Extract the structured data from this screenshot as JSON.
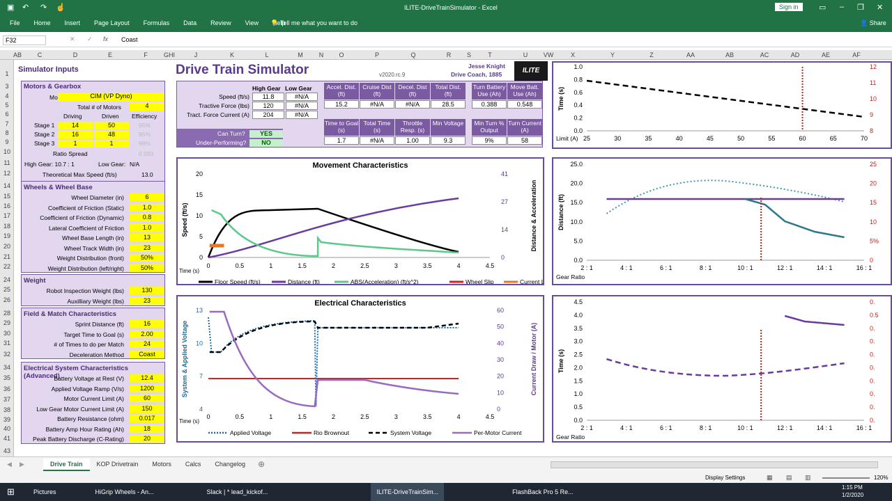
{
  "window": {
    "title": "ILITE-DriveTrainSimulator  -  Excel",
    "signin": "Sign in"
  },
  "ribbon": {
    "items": [
      "File",
      "Home",
      "Insert",
      "Page Layout",
      "Formulas",
      "Data",
      "Review",
      "View",
      "Help"
    ],
    "tell": "Tell me what you want to do",
    "share": "Share"
  },
  "formula": {
    "namebox": "F32",
    "content": "Coast"
  },
  "columns": [
    "AB",
    "C",
    "D",
    "E",
    "F",
    "GHI",
    "J",
    "K",
    "L",
    "M",
    "N",
    "O",
    "P",
    "Q",
    "R",
    "S",
    "T",
    "U",
    "VW",
    "X",
    "Y",
    "Z",
    "AA",
    "AB",
    "AC",
    "AD",
    "AE",
    "AF"
  ],
  "rows": [
    "1",
    "3",
    "4",
    "5",
    "6",
    "7",
    "8",
    "9",
    "10",
    "11",
    "12",
    "14",
    "15",
    "16",
    "17",
    "18",
    "19",
    "20",
    "21",
    "22",
    "24",
    "25",
    "26",
    "28",
    "29",
    "30",
    "31",
    "32",
    "34",
    "35",
    "36",
    "37",
    "38",
    "39",
    "40",
    "41",
    "43"
  ],
  "inputs": {
    "title": "Simulator Inputs",
    "motors_title": "Motors & Gearbox",
    "motor_label": "Motor",
    "motor_value": "CIM (VP Dyno)",
    "total_motors_label": "Total # of Motors",
    "total_motors": "4",
    "driving": "Driving",
    "driven": "Driven",
    "efficiency": "Efficiency",
    "stages": [
      {
        "label": "Stage 1",
        "driving": "14",
        "driven": "50",
        "eff": "95%"
      },
      {
        "label": "Stage 2",
        "driving": "16",
        "driven": "48",
        "eff": "95%"
      },
      {
        "label": "Stage 3",
        "driving": "1",
        "driven": "1",
        "eff": "98%"
      }
    ],
    "ratio_spread_label": "Ratio Spread",
    "ratio_spread": "0.093",
    "high_gear": "High Gear: 10.7 : 1",
    "low_gear": "Low Gear:",
    "low_gear_val": "N/A",
    "theo_label": "Theoretical Max Speed (ft/s)",
    "theo_val": "13.0",
    "wheels_title": "Wheels & Wheel Base",
    "wheels": [
      {
        "label": "Wheel Diameter (in)",
        "value": "6"
      },
      {
        "label": "Coefficient of Friction (Static)",
        "value": "1.0"
      },
      {
        "label": "Coefficient of Friction (Dynamic)",
        "value": "0.8"
      },
      {
        "label": "Lateral Coefficient of Friction",
        "value": "1.0"
      },
      {
        "label": "Wheel Base Length (in)",
        "value": "13"
      },
      {
        "label": "Wheel Track Width (in)",
        "value": "23"
      },
      {
        "label": "Weight Distribution (front)",
        "value": "50%"
      },
      {
        "label": "Weight Distribution (left/right)",
        "value": "50%"
      }
    ],
    "weight_title": "Weight",
    "weights": [
      {
        "label": "Robot Inspection Weight (lbs)",
        "value": "130"
      },
      {
        "label": "Auxilliary Weight (lbs)",
        "value": "23"
      }
    ],
    "field_title": "Field & Match Characteristics",
    "field": [
      {
        "label": "Sprint Distance (ft)",
        "value": "16"
      },
      {
        "label": "Target  Time to Goal (s)",
        "value": "2.00"
      },
      {
        "label": "# of Times to do per Match",
        "value": "24"
      },
      {
        "label": "Deceleration Method",
        "value": "Coast"
      }
    ],
    "elec_title": "Electrical System Characteristics (Advanced)",
    "elec": [
      {
        "label": "Battery Voltage at Rest (V)",
        "value": "12.4"
      },
      {
        "label": "Applied Voltage Ramp (V/s)",
        "value": "1200"
      },
      {
        "label": "Motor Current Limit (A)",
        "value": "60"
      },
      {
        "label": "Low Gear Motor Current Limit (A)",
        "value": "150"
      },
      {
        "label": "Battery Resistance (ohm)",
        "value": "0.017"
      },
      {
        "label": "Battery Amp Hour Rating (Ah)",
        "value": "18"
      },
      {
        "label": "Peak Battery Discharge (C-Rating)",
        "value": "20"
      }
    ]
  },
  "sim": {
    "title": "Drive Train Simulator",
    "version": "v2020.rc.9",
    "author": "Jesse Knight",
    "coach": "Drive Coach, 1885",
    "high_gear": "High Gear",
    "low_gear": "Low Gear",
    "rows": [
      {
        "label": "Speed (ft/s)",
        "high": "11.8",
        "low": "#N/A"
      },
      {
        "label": "Tractive Force (lbs)",
        "high": "120",
        "low": "#N/A"
      },
      {
        "label": "Tract. Force Current (A)",
        "high": "204",
        "low": "#N/A"
      }
    ],
    "can_turn_label": "Can Turn?",
    "can_turn": "YES",
    "under_label": "Under-Performing?",
    "under": "NO",
    "dist_hdr": [
      "Accel. Dist. (ft)",
      "Cruise Dist (ft)",
      "Decel. Dist (ft)",
      "Total Dist. (ft)"
    ],
    "dist_val": [
      "15.2",
      "#N/A",
      "#N/A",
      "28.5"
    ],
    "batt_hdr": [
      "Turn Battery Use (Ah)",
      "Move Batt. Use (Ah)"
    ],
    "batt_val": [
      "0.388",
      "0.548"
    ],
    "time_hdr": [
      "Time to Goal (s)",
      "Total Time (s)",
      "Throttle Resp. (s)",
      "Min Voltage"
    ],
    "time_val": [
      "1.7",
      "#N/A",
      "1.00",
      "9.3"
    ],
    "turn_hdr": [
      "Min Turn % Output",
      "Turn Current (A)"
    ],
    "turn_val": [
      "9%",
      "58"
    ]
  },
  "movement": {
    "title": "Movement Characteristics",
    "y1": "Speed (ft/s)",
    "y2": "Distance & Acceleration",
    "xlab": "Time (s)",
    "y1ticks": [
      "20",
      "15",
      "10",
      "5",
      "0"
    ],
    "y2ticks": [
      "41",
      "27",
      "14",
      "0"
    ],
    "xticks": [
      "0",
      "0.5",
      "1",
      "1.5",
      "2",
      "2.5",
      "3",
      "3.5",
      "4",
      "4.5"
    ],
    "legend": [
      "Floor Speed (ft/s)",
      "Distance (ft)",
      "ABS(Acceleration) (ft/s^2)",
      "Wheel Slip",
      "Current Limit"
    ]
  },
  "electrical": {
    "title": "Electrical Characteristics",
    "y1": "System & Applied Voltage",
    "y2": "Current Draw / Motor (A)",
    "xlab": "Time (s)",
    "y1ticks": [
      "13",
      "10",
      "7",
      "4"
    ],
    "y2ticks": [
      "60",
      "50",
      "40",
      "30",
      "20",
      "10",
      "0"
    ],
    "xticks": [
      "0",
      "0.5",
      "1",
      "1.5",
      "2",
      "2.5",
      "3",
      "3.5",
      "4",
      "4.5"
    ],
    "legend": [
      "Applied Voltage",
      "Rio Brownout",
      "System Voltage",
      "Per-Motor Current"
    ]
  },
  "chart_r1": {
    "ylab": "Time (s)",
    "yticks": [
      "1.0",
      "0.8",
      "0.6",
      "0.4",
      "0.2",
      "0.0"
    ],
    "y2ticks": [
      "12",
      "11",
      "10",
      "9",
      "8"
    ],
    "xlab": "Limit (A)",
    "xticks": [
      "25",
      "30",
      "35",
      "40",
      "45",
      "50",
      "55",
      "60",
      "65",
      "70"
    ]
  },
  "chart_r2": {
    "ylab": "Distance (ft)",
    "yticks": [
      "25.0",
      "20.0",
      "15.0",
      "10.0",
      "5.0",
      "0.0"
    ],
    "y2ticks": [
      "25",
      "20",
      "15",
      "10",
      "5%",
      "0"
    ],
    "xlab": "Gear Ratio",
    "xticks": [
      "2 : 1",
      "4 : 1",
      "6 : 1",
      "8 : 1",
      "10 : 1",
      "12 : 1",
      "14 : 1",
      "16 : 1"
    ]
  },
  "chart_r3": {
    "ylab": "Time (s)",
    "yticks": [
      "4.5",
      "4.0",
      "3.5",
      "3.0",
      "2.5",
      "2.0",
      "1.5",
      "1.0",
      "0.5",
      "0.0"
    ],
    "y2ticks": [
      "0.",
      "0.5",
      "0.",
      "0.",
      "0.",
      "0.",
      "0.",
      "0.",
      "0.",
      "0."
    ],
    "xlab": "Gear Ratio",
    "xticks": [
      "2 : 1",
      "4 : 1",
      "6 : 1",
      "8 : 1",
      "10 : 1",
      "12 : 1",
      "14 : 1",
      "16 : 1"
    ]
  },
  "tabs": [
    "Drive Train",
    "KOP Drivetrain",
    "Motors",
    "Calcs",
    "Changelog"
  ],
  "status": {
    "display": "Display Settings",
    "zoom": "120%"
  },
  "taskbar": {
    "items": [
      "Pictures",
      "HiGrip Wheels - An...",
      "Slack | * lead_kickof...",
      "ILITE-DriveTrainSim...",
      "FlashBack Pro 5 Re..."
    ],
    "time": "1:15 PM",
    "date": "1/2/2020"
  },
  "colors": {
    "excel_green": "#217346",
    "purple": "#7a5aa0",
    "yellow": "#ffff00"
  }
}
